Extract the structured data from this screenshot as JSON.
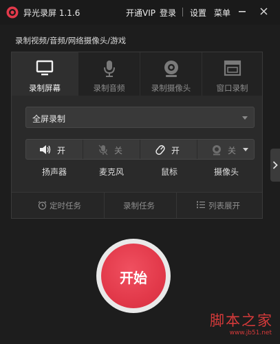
{
  "app": {
    "title": "异光录屏 1.1.6",
    "brand_color": "#e2394a"
  },
  "top_menu": {
    "vip": "开通VIP",
    "login": "登录",
    "settings": "设置",
    "menu": "菜单"
  },
  "subtitle": "录制视频/音频/网络摄像头/游戏",
  "tabs": [
    {
      "label": "录制屏幕",
      "icon": "monitor-icon",
      "active": true
    },
    {
      "label": "录制音频",
      "icon": "microphone-icon",
      "active": false
    },
    {
      "label": "录制摄像头",
      "icon": "webcam-icon",
      "active": false
    },
    {
      "label": "窗口录制",
      "icon": "window-icon",
      "active": false
    }
  ],
  "record_area": {
    "selected": "全屏录制"
  },
  "devices": [
    {
      "label": "扬声器",
      "state": "开",
      "icon": "speaker-icon",
      "on": true
    },
    {
      "label": "麦克风",
      "state": "关",
      "icon": "microphone-off-icon",
      "on": false
    },
    {
      "label": "鼠标",
      "state": "开",
      "icon": "mouse-icon",
      "on": true
    },
    {
      "label": "摄像头",
      "state": "关",
      "icon": "camera-icon",
      "on": false
    }
  ],
  "bottom_actions": [
    {
      "label": "定时任务",
      "icon": "alarm-clock-icon"
    },
    {
      "label": "录制任务",
      "icon": ""
    },
    {
      "label": "列表展开",
      "icon": "list-icon"
    }
  ],
  "start_button": {
    "label": "开始"
  },
  "watermark": {
    "text": "脚本之家",
    "url": "www.jb51.net"
  }
}
